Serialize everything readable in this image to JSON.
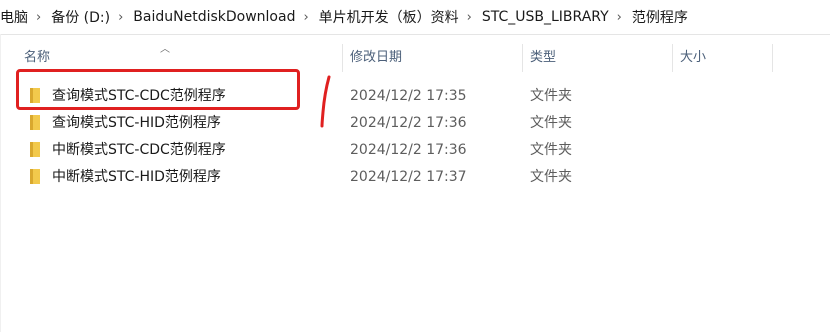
{
  "breadcrumb": [
    {
      "label": "电脑"
    },
    {
      "label": "备份 (D:)"
    },
    {
      "label": "BaiduNetdiskDownload"
    },
    {
      "label": "单片机开发（板）资料"
    },
    {
      "label": "STC_USB_LIBRARY"
    },
    {
      "label": "范例程序"
    }
  ],
  "columns": {
    "name": "名称",
    "date": "修改日期",
    "type": "类型",
    "size": "大小"
  },
  "rows": [
    {
      "name": "查询模式STC-CDC范例程序",
      "date": "2024/12/2 17:35",
      "type": "文件夹"
    },
    {
      "name": "查询模式STC-HID范例程序",
      "date": "2024/12/2 17:36",
      "type": "文件夹"
    },
    {
      "name": "中断模式STC-CDC范例程序",
      "date": "2024/12/2 17:36",
      "type": "文件夹"
    },
    {
      "name": "中断模式STC-HID范例程序",
      "date": "2024/12/2 17:37",
      "type": "文件夹"
    }
  ],
  "icons": {
    "folder": "folder-icon",
    "breadcrumb_separator": "chevron-right-icon",
    "sort_indicator": "sort-ascending-icon"
  },
  "colors": {
    "annotation": "#e02020",
    "folder": "#f2c94c",
    "header_text": "#4c607a"
  }
}
